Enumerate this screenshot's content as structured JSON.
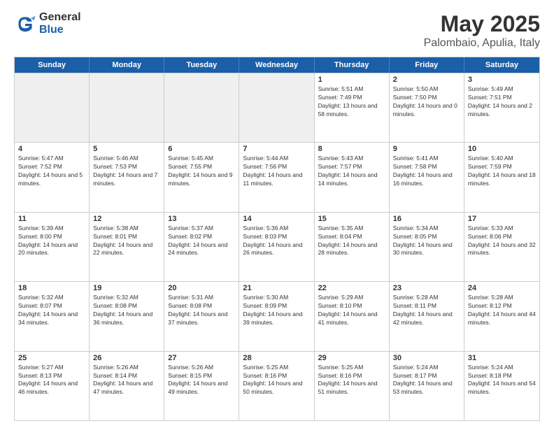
{
  "logo": {
    "general": "General",
    "blue": "Blue"
  },
  "title": {
    "month": "May 2025",
    "location": "Palombaio, Apulia, Italy"
  },
  "calendar": {
    "headers": [
      "Sunday",
      "Monday",
      "Tuesday",
      "Wednesday",
      "Thursday",
      "Friday",
      "Saturday"
    ],
    "rows": [
      [
        {
          "day": "",
          "empty": true
        },
        {
          "day": "",
          "empty": true
        },
        {
          "day": "",
          "empty": true
        },
        {
          "day": "",
          "empty": true
        },
        {
          "day": "1",
          "sunrise": "Sunrise: 5:51 AM",
          "sunset": "Sunset: 7:49 PM",
          "daylight": "Daylight: 13 hours and 58 minutes."
        },
        {
          "day": "2",
          "sunrise": "Sunrise: 5:50 AM",
          "sunset": "Sunset: 7:50 PM",
          "daylight": "Daylight: 14 hours and 0 minutes."
        },
        {
          "day": "3",
          "sunrise": "Sunrise: 5:49 AM",
          "sunset": "Sunset: 7:51 PM",
          "daylight": "Daylight: 14 hours and 2 minutes."
        }
      ],
      [
        {
          "day": "4",
          "sunrise": "Sunrise: 5:47 AM",
          "sunset": "Sunset: 7:52 PM",
          "daylight": "Daylight: 14 hours and 5 minutes."
        },
        {
          "day": "5",
          "sunrise": "Sunrise: 5:46 AM",
          "sunset": "Sunset: 7:53 PM",
          "daylight": "Daylight: 14 hours and 7 minutes."
        },
        {
          "day": "6",
          "sunrise": "Sunrise: 5:45 AM",
          "sunset": "Sunset: 7:55 PM",
          "daylight": "Daylight: 14 hours and 9 minutes."
        },
        {
          "day": "7",
          "sunrise": "Sunrise: 5:44 AM",
          "sunset": "Sunset: 7:56 PM",
          "daylight": "Daylight: 14 hours and 11 minutes."
        },
        {
          "day": "8",
          "sunrise": "Sunrise: 5:43 AM",
          "sunset": "Sunset: 7:57 PM",
          "daylight": "Daylight: 14 hours and 14 minutes."
        },
        {
          "day": "9",
          "sunrise": "Sunrise: 5:41 AM",
          "sunset": "Sunset: 7:58 PM",
          "daylight": "Daylight: 14 hours and 16 minutes."
        },
        {
          "day": "10",
          "sunrise": "Sunrise: 5:40 AM",
          "sunset": "Sunset: 7:59 PM",
          "daylight": "Daylight: 14 hours and 18 minutes."
        }
      ],
      [
        {
          "day": "11",
          "sunrise": "Sunrise: 5:39 AM",
          "sunset": "Sunset: 8:00 PM",
          "daylight": "Daylight: 14 hours and 20 minutes."
        },
        {
          "day": "12",
          "sunrise": "Sunrise: 5:38 AM",
          "sunset": "Sunset: 8:01 PM",
          "daylight": "Daylight: 14 hours and 22 minutes."
        },
        {
          "day": "13",
          "sunrise": "Sunrise: 5:37 AM",
          "sunset": "Sunset: 8:02 PM",
          "daylight": "Daylight: 14 hours and 24 minutes."
        },
        {
          "day": "14",
          "sunrise": "Sunrise: 5:36 AM",
          "sunset": "Sunset: 8:03 PM",
          "daylight": "Daylight: 14 hours and 26 minutes."
        },
        {
          "day": "15",
          "sunrise": "Sunrise: 5:35 AM",
          "sunset": "Sunset: 8:04 PM",
          "daylight": "Daylight: 14 hours and 28 minutes."
        },
        {
          "day": "16",
          "sunrise": "Sunrise: 5:34 AM",
          "sunset": "Sunset: 8:05 PM",
          "daylight": "Daylight: 14 hours and 30 minutes."
        },
        {
          "day": "17",
          "sunrise": "Sunrise: 5:33 AM",
          "sunset": "Sunset: 8:06 PM",
          "daylight": "Daylight: 14 hours and 32 minutes."
        }
      ],
      [
        {
          "day": "18",
          "sunrise": "Sunrise: 5:32 AM",
          "sunset": "Sunset: 8:07 PM",
          "daylight": "Daylight: 14 hours and 34 minutes."
        },
        {
          "day": "19",
          "sunrise": "Sunrise: 5:32 AM",
          "sunset": "Sunset: 8:08 PM",
          "daylight": "Daylight: 14 hours and 36 minutes."
        },
        {
          "day": "20",
          "sunrise": "Sunrise: 5:31 AM",
          "sunset": "Sunset: 8:08 PM",
          "daylight": "Daylight: 14 hours and 37 minutes."
        },
        {
          "day": "21",
          "sunrise": "Sunrise: 5:30 AM",
          "sunset": "Sunset: 8:09 PM",
          "daylight": "Daylight: 14 hours and 39 minutes."
        },
        {
          "day": "22",
          "sunrise": "Sunrise: 5:29 AM",
          "sunset": "Sunset: 8:10 PM",
          "daylight": "Daylight: 14 hours and 41 minutes."
        },
        {
          "day": "23",
          "sunrise": "Sunrise: 5:28 AM",
          "sunset": "Sunset: 8:11 PM",
          "daylight": "Daylight: 14 hours and 42 minutes."
        },
        {
          "day": "24",
          "sunrise": "Sunrise: 5:28 AM",
          "sunset": "Sunset: 8:12 PM",
          "daylight": "Daylight: 14 hours and 44 minutes."
        }
      ],
      [
        {
          "day": "25",
          "sunrise": "Sunrise: 5:27 AM",
          "sunset": "Sunset: 8:13 PM",
          "daylight": "Daylight: 14 hours and 46 minutes."
        },
        {
          "day": "26",
          "sunrise": "Sunrise: 5:26 AM",
          "sunset": "Sunset: 8:14 PM",
          "daylight": "Daylight: 14 hours and 47 minutes."
        },
        {
          "day": "27",
          "sunrise": "Sunrise: 5:26 AM",
          "sunset": "Sunset: 8:15 PM",
          "daylight": "Daylight: 14 hours and 49 minutes."
        },
        {
          "day": "28",
          "sunrise": "Sunrise: 5:25 AM",
          "sunset": "Sunset: 8:16 PM",
          "daylight": "Daylight: 14 hours and 50 minutes."
        },
        {
          "day": "29",
          "sunrise": "Sunrise: 5:25 AM",
          "sunset": "Sunset: 8:16 PM",
          "daylight": "Daylight: 14 hours and 51 minutes."
        },
        {
          "day": "30",
          "sunrise": "Sunrise: 5:24 AM",
          "sunset": "Sunset: 8:17 PM",
          "daylight": "Daylight: 14 hours and 53 minutes."
        },
        {
          "day": "31",
          "sunrise": "Sunrise: 5:24 AM",
          "sunset": "Sunset: 8:18 PM",
          "daylight": "Daylight: 14 hours and 54 minutes."
        }
      ]
    ]
  }
}
